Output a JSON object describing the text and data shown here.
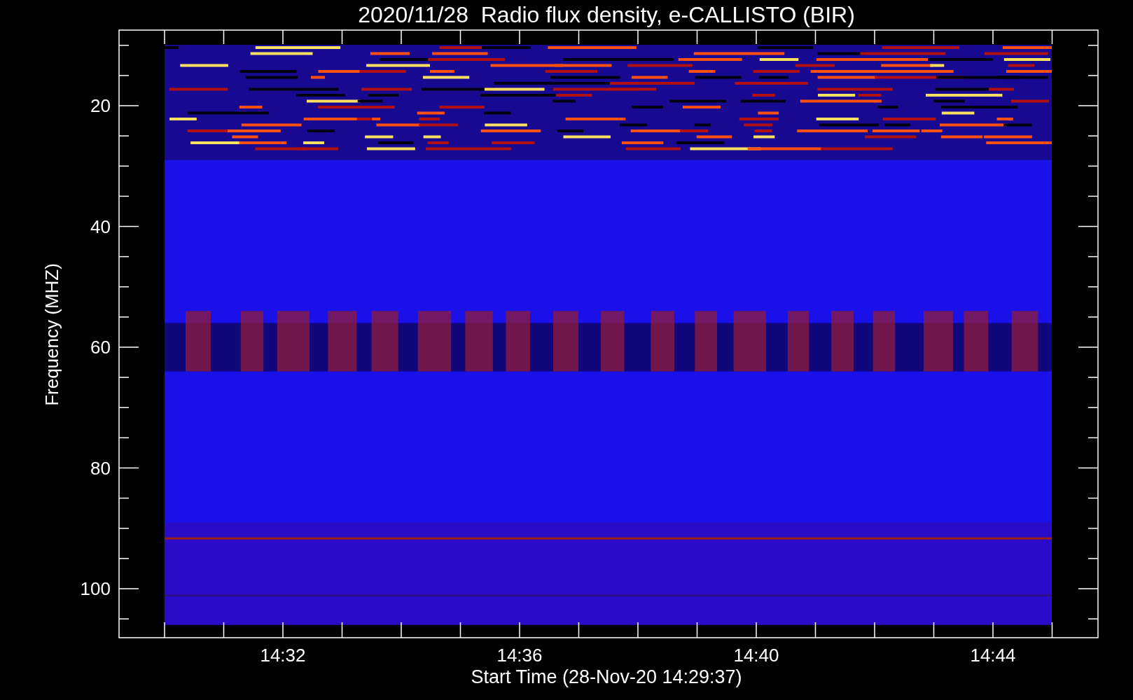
{
  "title": "2020/11/28  Radio flux density, e-CALLISTO (BIR)",
  "y_axis": {
    "label": "Frequency (MHZ)",
    "ticks": [
      "20",
      "40",
      "60",
      "80",
      "100"
    ]
  },
  "x_axis": {
    "label": "Start Time (28-Nov-20 14:29:37)",
    "ticks": [
      "14:32",
      "14:36",
      "14:40",
      "14:44"
    ]
  }
}
